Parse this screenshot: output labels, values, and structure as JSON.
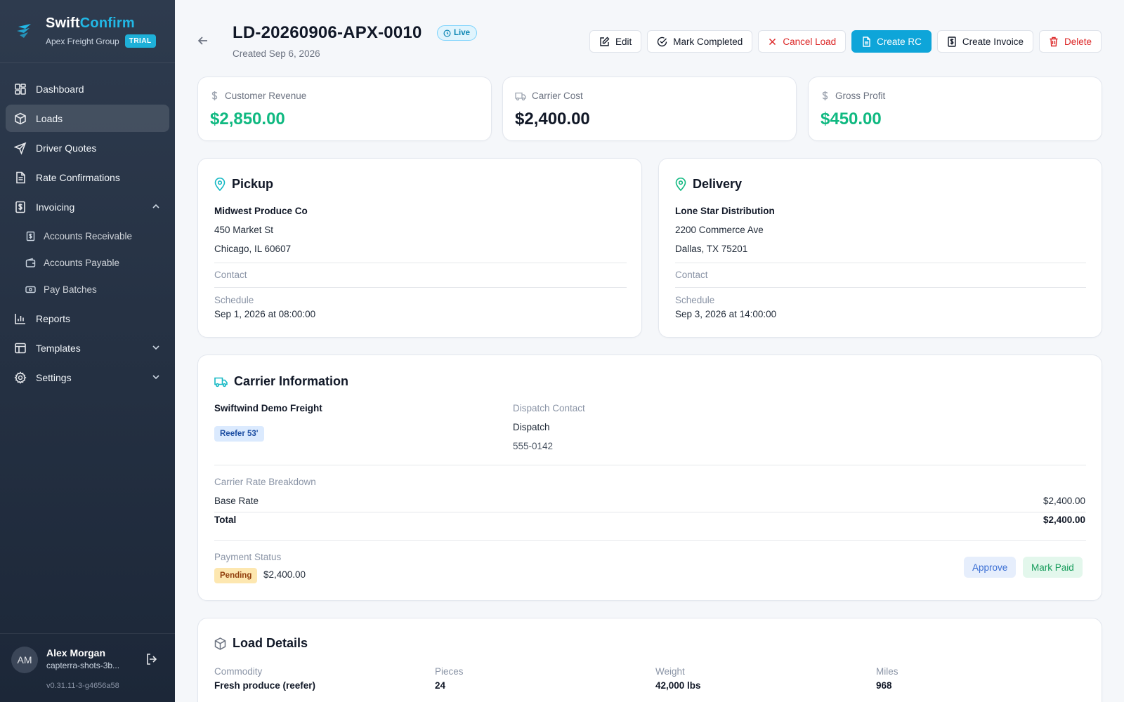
{
  "brand": {
    "name_part1": "Swift",
    "name_part2": "Confirm",
    "org": "Apex Freight Group",
    "badge": "TRIAL"
  },
  "sidebar": {
    "items": [
      {
        "label": "Dashboard",
        "icon": "dashboard-icon"
      },
      {
        "label": "Loads",
        "icon": "box-icon",
        "active": true
      },
      {
        "label": "Driver Quotes",
        "icon": "send-icon"
      },
      {
        "label": "Rate Confirmations",
        "icon": "document-icon"
      },
      {
        "label": "Invoicing",
        "icon": "invoice-icon",
        "expanded": true
      },
      {
        "label": "Reports",
        "icon": "bar-chart-icon"
      },
      {
        "label": "Templates",
        "icon": "layout-icon"
      },
      {
        "label": "Settings",
        "icon": "gear-icon"
      }
    ],
    "sub_items": [
      {
        "label": "Accounts Receivable",
        "icon": "receivable-icon"
      },
      {
        "label": "Accounts Payable",
        "icon": "wallet-icon"
      },
      {
        "label": "Pay Batches",
        "icon": "cash-icon"
      }
    ]
  },
  "user": {
    "initials": "AM",
    "name": "Alex Morgan",
    "email": "capterra-shots-3b...",
    "version": "v0.31.11-3-g4656a58"
  },
  "header": {
    "title": "LD-20260906-APX-0010",
    "status": "Live",
    "created": "Created Sep 6, 2026"
  },
  "actions": {
    "edit": "Edit",
    "complete": "Mark Completed",
    "cancel": "Cancel Load",
    "create_rc": "Create RC",
    "invoice": "Create Invoice",
    "delete": "Delete"
  },
  "stats": {
    "revenue_label": "Customer Revenue",
    "revenue": "$2,850.00",
    "cost_label": "Carrier Cost",
    "cost": "$2,400.00",
    "profit_label": "Gross Profit",
    "profit": "$450.00"
  },
  "pickup": {
    "title": "Pickup",
    "company": "Midwest Produce Co",
    "address1": "450 Market St",
    "address2": "Chicago, IL 60607",
    "contact_label": "Contact",
    "schedule_label": "Schedule",
    "schedule": "Sep 1, 2026 at 08:00:00"
  },
  "delivery": {
    "title": "Delivery",
    "company": "Lone Star Distribution",
    "address1": "2200 Commerce Ave",
    "address2": "Dallas, TX 75201",
    "contact_label": "Contact",
    "schedule_label": "Schedule",
    "schedule": "Sep 3, 2026 at 14:00:00"
  },
  "carrier": {
    "title": "Carrier Information",
    "name": "Swiftwind Demo Freight",
    "equipment": "Reefer 53'",
    "dispatch_label": "Dispatch Contact",
    "dispatch_name": "Dispatch",
    "dispatch_phone": "555-0142",
    "breakdown_label": "Carrier Rate Breakdown",
    "base_label": "Base Rate",
    "base_value": "$2,400.00",
    "total_label": "Total",
    "total_value": "$2,400.00",
    "payment_label": "Payment Status",
    "payment_status": "Pending",
    "payment_amount": "$2,400.00",
    "approve": "Approve",
    "mark_paid": "Mark Paid"
  },
  "load": {
    "title": "Load Details",
    "commodity_label": "Commodity",
    "commodity": "Fresh produce (reefer)",
    "pieces_label": "Pieces",
    "pieces": "24",
    "weight_label": "Weight",
    "weight": "42,000 lbs",
    "miles_label": "Miles",
    "miles": "968"
  },
  "colors": {
    "accent": "#0ea5d9",
    "money_green": "#10b981",
    "danger": "#dc2626",
    "sidebar_bg": "#2e3b4e"
  }
}
